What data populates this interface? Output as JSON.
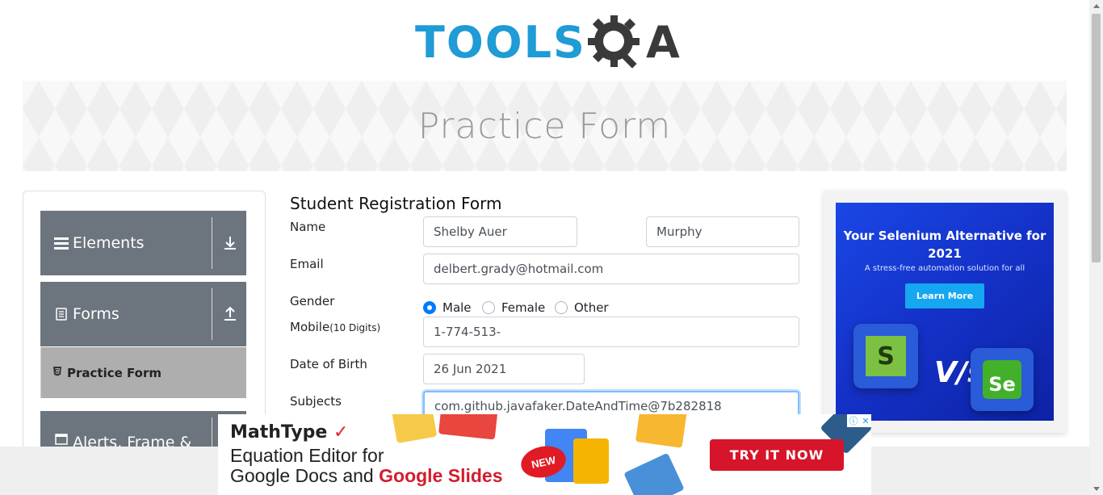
{
  "logo": {
    "text_tools": "TOOLS",
    "text_qa": "A",
    "icon": "gear-magnifier-icon"
  },
  "banner": {
    "title": "Practice Form"
  },
  "sidebar": {
    "groups": [
      {
        "label": "Elements",
        "icon": "hamburger-icon",
        "arrow": "download-arrow-icon"
      },
      {
        "label": "Forms",
        "icon": "document-icon",
        "arrow": "upload-arrow-icon"
      },
      {
        "label": "Alerts, Frame &",
        "icon": "window-icon"
      }
    ],
    "active_item": {
      "label": "Practice Form",
      "icon": "html5-icon"
    }
  },
  "form": {
    "heading": "Student Registration Form",
    "labels": {
      "name": "Name",
      "email": "Email",
      "gender": "Gender",
      "mobile": "Mobile",
      "mobile_hint": "(10 Digits)",
      "dob": "Date of Birth",
      "subjects": "Subjects"
    },
    "values": {
      "first_name": "Shelby Auer",
      "last_name": "Murphy",
      "email": "delbert.grady@hotmail.com",
      "mobile": "1-774-513-",
      "dob": "26 Jun 2021",
      "subjects": "com.github.javafaker.DateAndTime@7b282818"
    },
    "gender_options": [
      "Male",
      "Female",
      "Other"
    ],
    "gender_selected": "Male"
  },
  "right_ad": {
    "headline": "Your Selenium Alternative for 2021",
    "sub": "A stress-free automation solution for all",
    "button": "Learn More",
    "vs": "V/s",
    "logo_left": "S",
    "logo_right": "Se"
  },
  "bottom_ad": {
    "brand": "MathType",
    "line1": "Equation Editor for",
    "line2_plain": "Google Docs and ",
    "line2_bold": "Google Slides",
    "badge": "NEW",
    "cta": "TRY IT NOW"
  },
  "colors": {
    "brand_blue": "#1f9bd6",
    "nav_gray": "#6c757d",
    "primary": "#007bff",
    "cta_red": "#d6152a"
  }
}
